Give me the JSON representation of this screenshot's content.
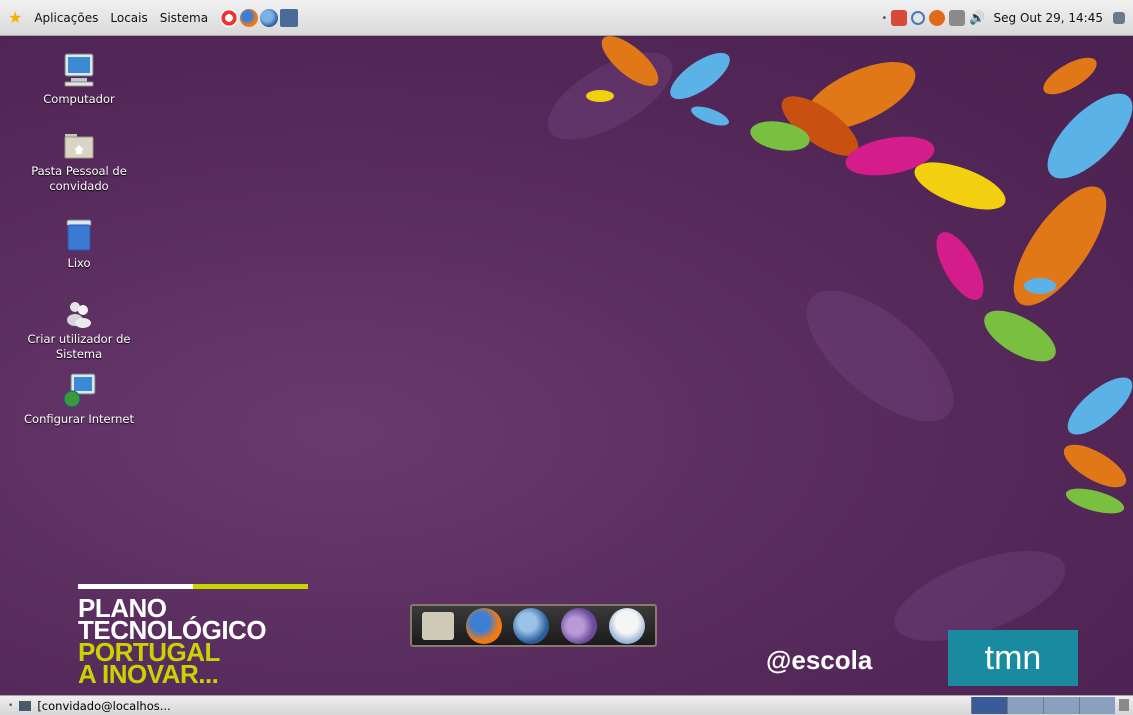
{
  "top_panel": {
    "menus": [
      "Aplicações",
      "Locais",
      "Sistema"
    ],
    "clock": "Seg Out 29, 14:45"
  },
  "desktop_icons": [
    {
      "label": "Computador",
      "icon": "computer-icon"
    },
    {
      "label": "Pasta Pessoal de convidado",
      "icon": "home-folder-icon"
    },
    {
      "label": "Lixo",
      "icon": "trash-icon"
    },
    {
      "label": "Criar utilizador de Sistema",
      "icon": "users-icon"
    },
    {
      "label": "Configurar Internet",
      "icon": "network-icon"
    }
  ],
  "branding": {
    "plano_line1": "PLANO",
    "plano_line2": "TECNOLÓGICO",
    "plano_line3": "PORTUGAL",
    "plano_line4": "A INOVAR...",
    "escola": "@escola",
    "tmn": "tmn"
  },
  "dock": {
    "items": [
      "home-folder-icon",
      "firefox-icon",
      "thunderbird-icon",
      "pidgin-icon",
      "office-icon"
    ]
  },
  "bottom_panel": {
    "task_label": "[convidado@localhos..."
  },
  "colors": {
    "desktop_bg": "#55295a",
    "tmn_bg": "#1a8aa0",
    "plano_green": "#c8d400"
  }
}
